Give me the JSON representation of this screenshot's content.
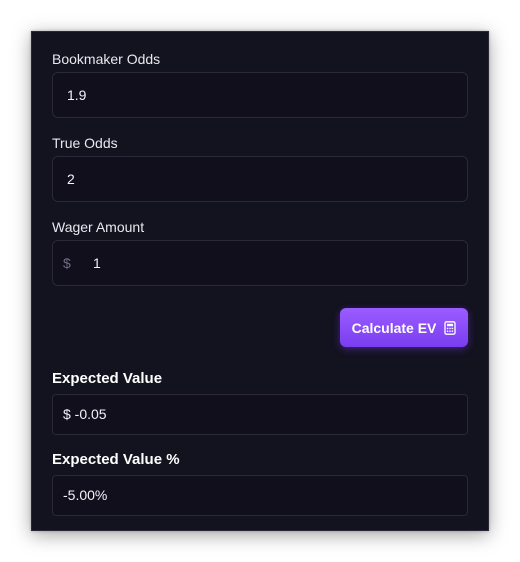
{
  "form": {
    "bookmaker_odds": {
      "label": "Bookmaker Odds",
      "value": "1.9"
    },
    "true_odds": {
      "label": "True Odds",
      "value": "2"
    },
    "wager_amount": {
      "label": "Wager Amount",
      "prefix": "$",
      "value": "1"
    }
  },
  "button": {
    "label": "Calculate EV",
    "icon": "calculator-icon"
  },
  "results": {
    "ev": {
      "label": "Expected Value",
      "value": "$ -0.05"
    },
    "ev_percent": {
      "label": "Expected Value %",
      "value": "-5.00%"
    }
  },
  "colors": {
    "background": "#13121f",
    "field": "#100f1b",
    "accent": "#8b4dfa"
  }
}
